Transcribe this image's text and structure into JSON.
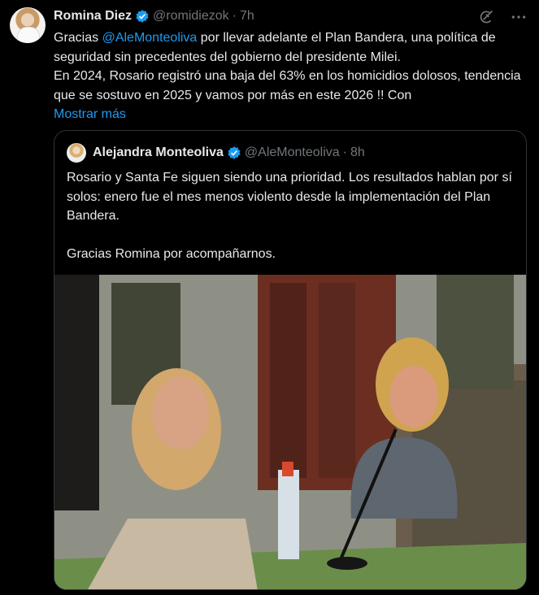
{
  "tweet": {
    "author_name": "Romina Diez",
    "author_handle": "@romidiezok",
    "separator": "·",
    "time": "7h",
    "text_before_mention": "Gracias ",
    "mention": "@AleMonteoliva",
    "text_after_mention": " por llevar adelante el Plan Bandera, una política de seguridad sin precedentes del gobierno del presidente Milei.\nEn 2024, Rosario registró una baja del 63% en los homicidios dolosos, tendencia que se sostuvo en 2025 y vamos por más en este 2026 !! Con",
    "show_more": "Mostrar más"
  },
  "quoted": {
    "author_name": "Alejandra Monteoliva",
    "author_handle": "@AleMonteoliva",
    "separator": "·",
    "time": "8h",
    "text": "Rosario y Santa Fe siguen siendo una prioridad. Los resultados hablan por sí solos: enero fue el mes menos violento desde la implementación del Plan Bandera.\n\nGracias Romina por acompañarnos."
  },
  "icons": {
    "verified": "verified-badge-icon",
    "grok": "grok-icon",
    "more": "more-options-icon"
  },
  "colors": {
    "background": "#000000",
    "text": "#e7e9ea",
    "secondary": "#71767b",
    "link": "#1d9bf0",
    "border": "#2f3336"
  }
}
